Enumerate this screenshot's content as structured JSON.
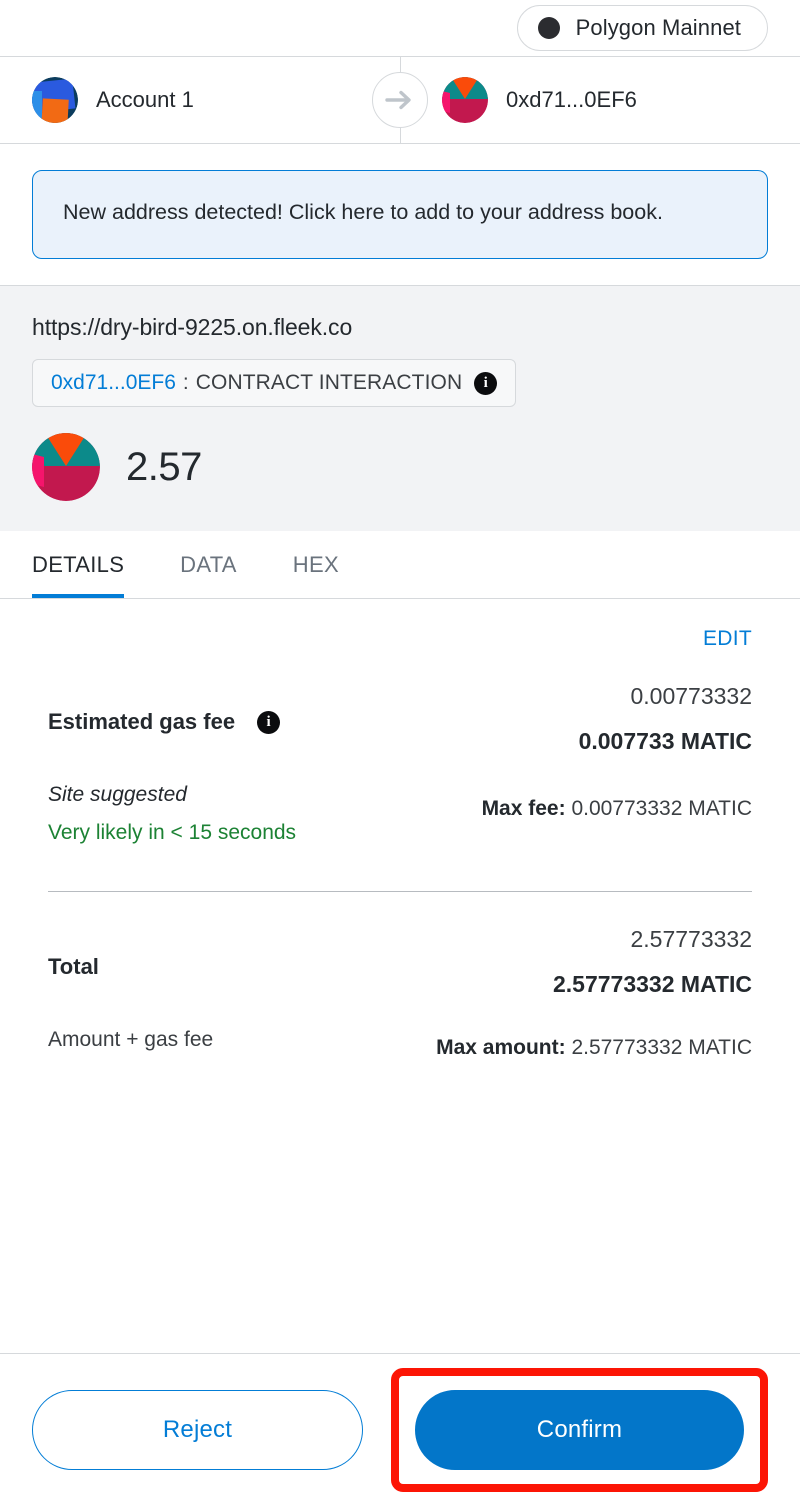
{
  "network": {
    "name": "Polygon Mainnet",
    "dot_color": "#2b2c30"
  },
  "accounts": {
    "sender_name": "Account 1",
    "recipient_name": "0xd71...0EF6",
    "arrow_icon": "arrow-right-icon"
  },
  "banner": {
    "text": "New address detected! Click here to add to your address book."
  },
  "origin": {
    "url": "https://dry-bird-9225.on.fleek.co",
    "pill_address": "0xd71...0EF6",
    "pill_separator": ":",
    "pill_label": "CONTRACT INTERACTION",
    "info_icon_glyph": "i"
  },
  "amount": {
    "value": "2.57"
  },
  "tabs": [
    {
      "label": "DETAILS",
      "active": true
    },
    {
      "label": "DATA",
      "active": false
    },
    {
      "label": "HEX",
      "active": false
    }
  ],
  "details": {
    "edit_label": "EDIT",
    "gas": {
      "title": "Estimated gas fee",
      "info_icon_glyph": "i",
      "site_suggested": "Site suggested",
      "speed_text": "Very likely in < 15 seconds",
      "fiat": "0.00773332",
      "native": "0.007733 MATIC",
      "max_fee_label": "Max fee:",
      "max_fee_value": "0.00773332 MATIC"
    },
    "total": {
      "title": "Total",
      "subtitle": "Amount + gas fee",
      "fiat": "2.57773332",
      "native": "2.57773332 MATIC",
      "max_amount_label": "Max amount:",
      "max_amount_value": "2.57773332 MATIC"
    }
  },
  "footer": {
    "reject_label": "Reject",
    "confirm_label": "Confirm",
    "highlight_color": "#fc1505"
  },
  "colors": {
    "accent_blue": "#037dd6",
    "confirm_blue": "#0376c9",
    "green": "#1c8234",
    "gray_bg": "#f2f3f5",
    "banner_bg": "#eaf2fb"
  }
}
